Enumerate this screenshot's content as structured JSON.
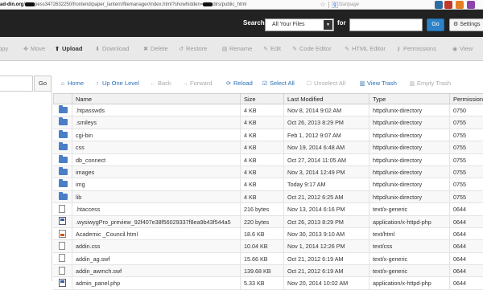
{
  "browser": {
    "url_host": "ad-din.org",
    "url_path": "pess3472632250/frontend/paper_lantern/filemanager/index.html?showhidden=",
    "url_tail": "dirs/public_html",
    "search_engine": "Startpage"
  },
  "header": {
    "search_label": "Search",
    "scope_value": "All Your Files",
    "for_label": "for",
    "for_value": "",
    "go_label": "Go",
    "settings_label": "Settings"
  },
  "toolbar": {
    "copy": "opy",
    "move": "Move",
    "upload": "Upload",
    "download": "Download",
    "delete": "Delete",
    "restore": "Restore",
    "rename": "Rename",
    "edit": "Edit",
    "code_editor": "Code Editor",
    "html_editor": "HTML Editor",
    "permissions": "Permissions",
    "view": "View"
  },
  "nav": {
    "go_label": "Go",
    "home": "Home",
    "up_one_level": "Up One Level",
    "back": "Back",
    "forward": "Forward",
    "reload": "Reload",
    "select_all": "Select All",
    "unselect_all": "Unselect All",
    "view_trash": "View Trash",
    "empty_trash": "Empty Trash"
  },
  "table": {
    "columns": [
      "Name",
      "Size",
      "Last Modified",
      "Type",
      "Permissions"
    ],
    "rows": [
      {
        "icon": "folder",
        "name": ".htpasswds",
        "size": "4 KB",
        "modified": "Nov 8, 2014 9:02 AM",
        "type": "httpd/unix-directory",
        "perm": "0750"
      },
      {
        "icon": "folder",
        "name": ".smileys",
        "size": "4 KB",
        "modified": "Oct 26, 2013 8:29 PM",
        "type": "httpd/unix-directory",
        "perm": "0755"
      },
      {
        "icon": "folder",
        "name": "cgi-bin",
        "size": "4 KB",
        "modified": "Feb 1, 2012 9:07 AM",
        "type": "httpd/unix-directory",
        "perm": "0755"
      },
      {
        "icon": "folder",
        "name": "css",
        "size": "4 KB",
        "modified": "Nov 19, 2014 6:48 AM",
        "type": "httpd/unix-directory",
        "perm": "0755"
      },
      {
        "icon": "folder",
        "name": "db_connect",
        "size": "4 KB",
        "modified": "Oct 27, 2014 11:05 AM",
        "type": "httpd/unix-directory",
        "perm": "0755"
      },
      {
        "icon": "folder",
        "name": "images",
        "size": "4 KB",
        "modified": "Nov 3, 2014 12:49 PM",
        "type": "httpd/unix-directory",
        "perm": "0755"
      },
      {
        "icon": "folder",
        "name": "img",
        "size": "4 KB",
        "modified": "Today 9:17 AM",
        "type": "httpd/unix-directory",
        "perm": "0755"
      },
      {
        "icon": "folder",
        "name": "lib",
        "size": "4 KB",
        "modified": "Oct 21, 2012 6:25 AM",
        "type": "httpd/unix-directory",
        "perm": "0755"
      },
      {
        "icon": "doc",
        "name": ".htaccess",
        "size": "216 bytes",
        "modified": "Nov 13, 2014 6:16 PM",
        "type": "text/x-generic",
        "perm": "0644"
      },
      {
        "icon": "code",
        "name": ".wysiwygPro_preview_92f407e38f56029337f8ea9b43f544a5",
        "size": "220 bytes",
        "modified": "Oct 26, 2013 8:29 PM",
        "type": "application/x-httpd-php",
        "perm": "0644"
      },
      {
        "icon": "html",
        "name": "Academic _Council.html",
        "size": "18.6 KB",
        "modified": "Nov 30, 2013 9:10 AM",
        "type": "text/html",
        "perm": "0644"
      },
      {
        "icon": "doc",
        "name": "addin.css",
        "size": "10.04 KB",
        "modified": "Nov 1, 2014 12:26 PM",
        "type": "text/css",
        "perm": "0644"
      },
      {
        "icon": "doc",
        "name": "addin_ag.swf",
        "size": "15.66 KB",
        "modified": "Oct 21, 2012 6:19 AM",
        "type": "text/x-generic",
        "perm": "0644"
      },
      {
        "icon": "doc",
        "name": "addin_awmch.swf",
        "size": "139.68 KB",
        "modified": "Oct 21, 2012 6:19 AM",
        "type": "text/x-generic",
        "perm": "0644"
      },
      {
        "icon": "code",
        "name": "admin_panel.php",
        "size": "5.33 KB",
        "modified": "Nov 20, 2014 10:02 AM",
        "type": "application/x-httpd-php",
        "perm": "0644"
      }
    ]
  }
}
